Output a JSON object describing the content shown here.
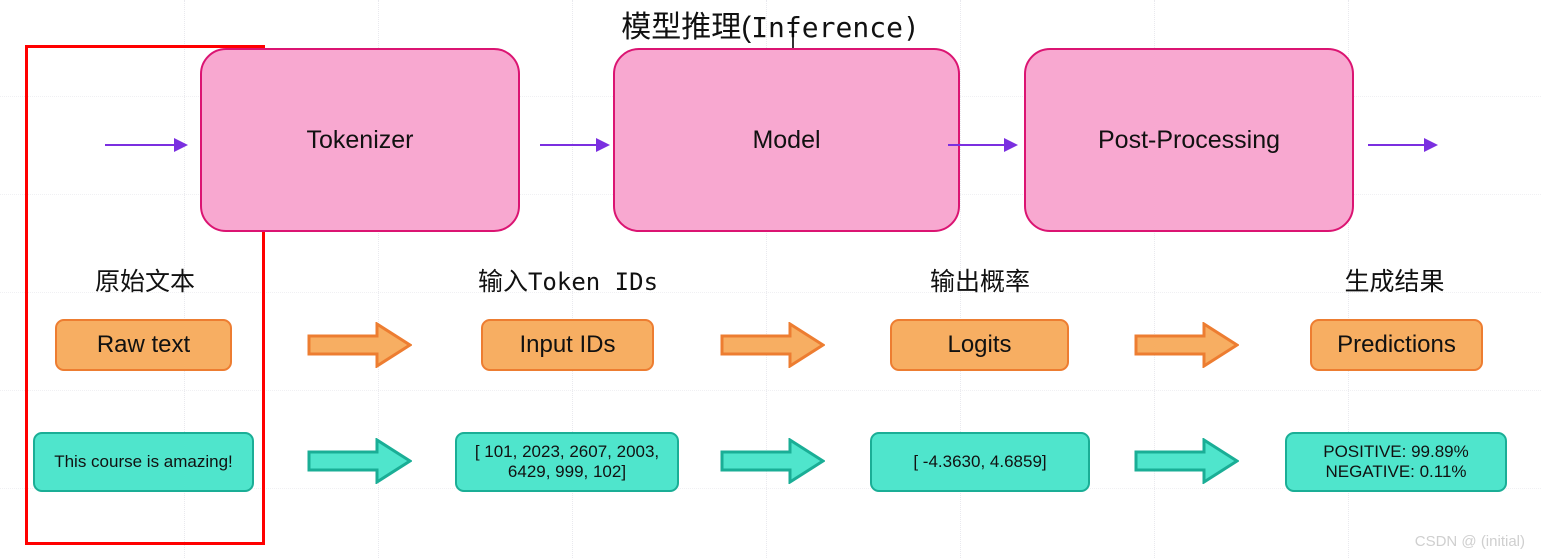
{
  "title": {
    "cn": "模型推理(",
    "en": "Inference",
    "close": ")"
  },
  "pipeline": {
    "stages": [
      {
        "label": "Tokenizer"
      },
      {
        "label": "Model"
      },
      {
        "label": "Post-Processing"
      }
    ]
  },
  "columns": [
    {
      "label_cn": "原始文本",
      "label_mono": "",
      "stage_label": "Raw text",
      "value": "This course is amazing!"
    },
    {
      "label_cn": "输入",
      "label_mono": "Token IDs",
      "stage_label": "Input IDs",
      "value": "[ 101, 2023, 2607, 2003, 6429, 999, 102]"
    },
    {
      "label_cn": "输出概率",
      "label_mono": "",
      "stage_label": "Logits",
      "value": "[ -4.3630, 4.6859]"
    },
    {
      "label_cn": "生成结果",
      "label_mono": "",
      "stage_label": "Predictions",
      "value_line1": "POSITIVE: 99.89%",
      "value_line2": "NEGATIVE:  0.11%"
    }
  ],
  "watermark": "CSDN @ (initial)",
  "colors": {
    "pink_fill": "#f8a8d0",
    "pink_border": "#db1472",
    "orange_fill": "#f7ae62",
    "orange_border": "#ed7d31",
    "teal_fill": "#4fe5cc",
    "teal_border": "#1aae96",
    "purple_arrow": "#7b2fe0",
    "highlight_rect": "#ff0000"
  }
}
